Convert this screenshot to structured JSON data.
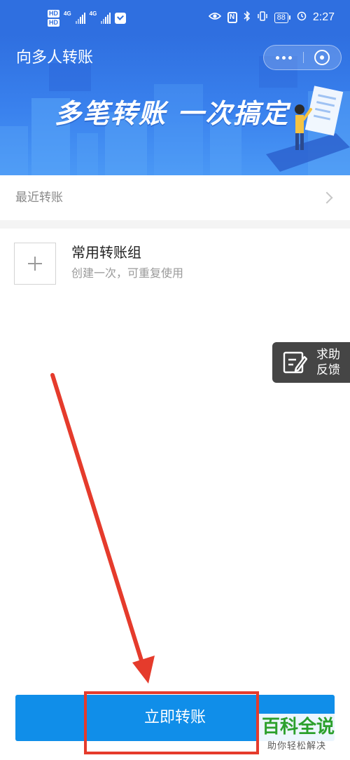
{
  "status_bar": {
    "hd_1": "HD",
    "hd_2": "HD",
    "net_1": "4G",
    "net_2": "4G",
    "nfc_glyph": "N",
    "battery": "88",
    "time": "2:27"
  },
  "header": {
    "title": "向多人转账"
  },
  "banner": {
    "slogan": "多笔转账  一次搞定"
  },
  "recent": {
    "label": "最近转账"
  },
  "group": {
    "title": "常用转账组",
    "subtitle": "创建一次，可重复使用"
  },
  "help": {
    "line1": "求助",
    "line2": "反馈"
  },
  "bottom": {
    "button_label": "立即转账"
  },
  "watermark": {
    "title": "百科全说",
    "subtitle": "助你轻松解决"
  },
  "colors": {
    "brand_blue": "#2f6fe0",
    "button_blue": "#108ee9",
    "annotation_red": "#e53b2c",
    "watermark_green": "#2ca02c"
  },
  "icons": {
    "more": "more-dots-icon",
    "close": "close-circle-icon",
    "chevron": "chevron-right-icon",
    "plus": "plus-icon",
    "edit": "edit-icon",
    "eye": "eye-icon",
    "bluetooth": "bluetooth-icon",
    "vibrate": "vibrate-icon",
    "alarm": "alarm-icon"
  }
}
